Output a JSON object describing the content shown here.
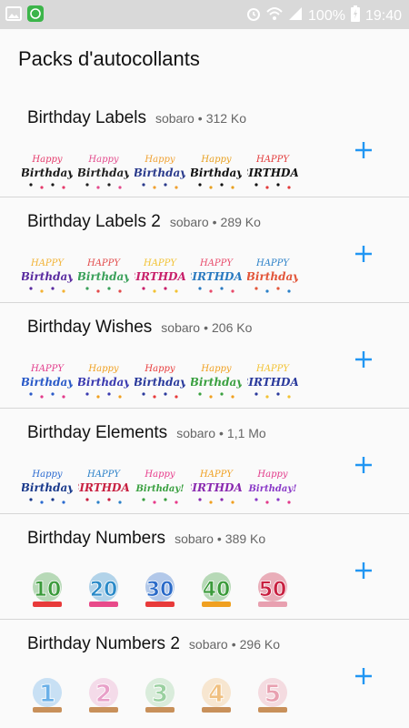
{
  "status": {
    "battery_text": "100%",
    "time": "19:40"
  },
  "header": {
    "title": "Packs d'autocollants"
  },
  "packs": [
    {
      "name": "Birthday Labels",
      "publisher": "sobaro",
      "size": "312 Ko",
      "sep": "•",
      "stickers": [
        {
          "text": "Birthday",
          "top": "Happy",
          "c1": "#1a1a1a",
          "c2": "#e53a6b"
        },
        {
          "text": "Birthday",
          "top": "Happy",
          "c1": "#222",
          "c2": "#e34a8c"
        },
        {
          "text": "Birthday",
          "top": "Happy",
          "c1": "#2a3a8c",
          "c2": "#f0a030"
        },
        {
          "text": "Birthday",
          "top": "Happy",
          "c1": "#111",
          "c2": "#e8a020"
        },
        {
          "text": "BIRTHDAY",
          "top": "HAPPY",
          "c1": "#111",
          "c2": "#e23a3a"
        }
      ]
    },
    {
      "name": "Birthday Labels 2",
      "publisher": "sobaro",
      "size": "289 Ko",
      "sep": "•",
      "stickers": [
        {
          "text": "Birthday",
          "top": "HAPPY",
          "c1": "#5a2ca0",
          "c2": "#f2b233"
        },
        {
          "text": "Birthday",
          "top": "HAPPY",
          "c1": "#3aa05a",
          "c2": "#e24a4a"
        },
        {
          "text": "BIRTHDAY",
          "top": "HAPPY",
          "c1": "#c8206a",
          "c2": "#f2c233"
        },
        {
          "text": "BIRTHDAY",
          "top": "HAPPY",
          "c1": "#2a7ac0",
          "c2": "#e84a6a"
        },
        {
          "text": "Birthday",
          "top": "HAPPY",
          "c1": "#e2563a",
          "c2": "#2a80c8"
        }
      ]
    },
    {
      "name": "Birthday Wishes",
      "publisher": "sobaro",
      "size": "206 Ko",
      "sep": "•",
      "stickers": [
        {
          "text": "Birthday",
          "top": "HAPPY",
          "c1": "#2a5ac8",
          "c2": "#e23a8a"
        },
        {
          "text": "Birthday",
          "top": "Happy",
          "c1": "#3a3ab0",
          "c2": "#f0a020"
        },
        {
          "text": "Birthday",
          "top": "Happy",
          "c1": "#2a3a9c",
          "c2": "#e83a3a"
        },
        {
          "text": "Birthday",
          "top": "Happy",
          "c1": "#3aa040",
          "c2": "#f0a020"
        },
        {
          "text": "BIRTHDAY",
          "top": "HAPPY",
          "c1": "#2a3a9c",
          "c2": "#f2c233"
        }
      ]
    },
    {
      "name": "Birthday Elements",
      "publisher": "sobaro",
      "size": "1,1 Mo",
      "sep": "•",
      "stickers": [
        {
          "text": "Birthday",
          "top": "Happy",
          "c1": "#1a3a8c",
          "c2": "#2a6ad0"
        },
        {
          "text": "BIRTHDAY",
          "top": "HAPPY",
          "c1": "#c82040",
          "c2": "#2a80c8"
        },
        {
          "text": "Birthday!",
          "top": "Happy",
          "c1": "#3aa040",
          "c2": "#e83a8a"
        },
        {
          "text": "BIRTHDAY",
          "top": "HAPPY",
          "c1": "#8a2ab0",
          "c2": "#f0a020"
        },
        {
          "text": "Birthday!",
          "top": "Happy",
          "c1": "#8a3ac8",
          "c2": "#e23a8a"
        }
      ]
    },
    {
      "name": "Birthday Numbers",
      "publisher": "sobaro",
      "size": "389 Ko",
      "sep": "•",
      "stickers": [
        {
          "text": "10",
          "top": "",
          "c1": "#3a9a3a",
          "c2": "#e83a3a"
        },
        {
          "text": "20",
          "top": "",
          "c1": "#2a8ac8",
          "c2": "#e84a8a"
        },
        {
          "text": "30",
          "top": "",
          "c1": "#2a6ac8",
          "c2": "#e83a3a"
        },
        {
          "text": "40",
          "top": "",
          "c1": "#3a9a3a",
          "c2": "#f0a020"
        },
        {
          "text": "50",
          "top": "",
          "c1": "#c82040",
          "c2": "#e8a0b0"
        }
      ]
    },
    {
      "name": "Birthday Numbers 2",
      "publisher": "sobaro",
      "size": "296 Ko",
      "sep": "•",
      "stickers": [
        {
          "text": "1",
          "top": "",
          "c1": "#6ab0e8",
          "c2": "#c8905a"
        },
        {
          "text": "2",
          "top": "",
          "c1": "#e8a0c8",
          "c2": "#c8905a"
        },
        {
          "text": "3",
          "top": "",
          "c1": "#9ad0a0",
          "c2": "#c8905a"
        },
        {
          "text": "4",
          "top": "",
          "c1": "#f0c080",
          "c2": "#c8905a"
        },
        {
          "text": "5",
          "top": "",
          "c1": "#e8a0b0",
          "c2": "#c8905a"
        }
      ]
    }
  ],
  "colors": {
    "accent": "#2196f3"
  }
}
